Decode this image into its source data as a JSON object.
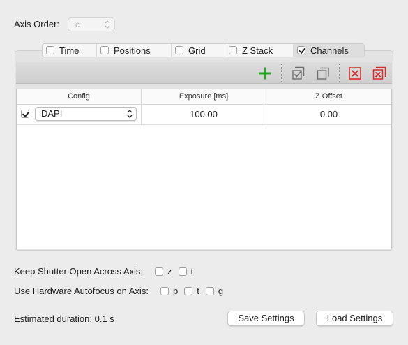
{
  "axis_order": {
    "label": "Axis Order:",
    "value": "c"
  },
  "tabs": [
    {
      "label": "Time",
      "checked": false
    },
    {
      "label": "Positions",
      "checked": false
    },
    {
      "label": "Grid",
      "checked": false
    },
    {
      "label": "Z Stack",
      "checked": false
    },
    {
      "label": "Channels",
      "checked": true
    }
  ],
  "toolbar": {
    "add": "plus-icon",
    "check_all": "check-all-icon",
    "duplicate": "duplicate-icon",
    "remove": "remove-icon",
    "remove_all": "remove-all-icon",
    "colors": {
      "add": "#2aa52a",
      "remove": "#d92c2c",
      "neutral": "#6f6f6f"
    }
  },
  "table": {
    "columns": [
      "Config",
      "Exposure [ms]",
      "Z Offset"
    ],
    "rows": [
      {
        "enabled": true,
        "config": "DAPI",
        "exposure": "100.00",
        "z_offset": "0.00"
      }
    ]
  },
  "shutter": {
    "label": "Keep Shutter Open Across Axis:",
    "options": [
      {
        "label": "z",
        "checked": false
      },
      {
        "label": "t",
        "checked": false
      }
    ]
  },
  "autofocus": {
    "label": "Use Hardware Autofocus on Axis:",
    "options": [
      {
        "label": "p",
        "checked": false
      },
      {
        "label": "t",
        "checked": false
      },
      {
        "label": "g",
        "checked": false
      }
    ]
  },
  "footer": {
    "estimate": "Estimated duration: 0.1 s",
    "save": "Save Settings",
    "load": "Load Settings"
  }
}
